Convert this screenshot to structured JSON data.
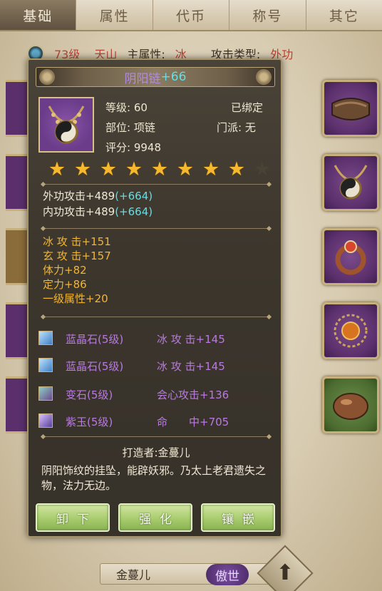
{
  "tabs": [
    "基础",
    "属性",
    "代币",
    "称号",
    "其它"
  ],
  "bg_stats": {
    "level": "73级",
    "sect": "天山",
    "main_attr_label": "主属性:",
    "main_attr_value": "冰",
    "attack_type_label": "攻击类型:",
    "attack_type_value": "外功"
  },
  "item": {
    "name": "阴阳链",
    "plus": "+66",
    "level": "等级: 60",
    "bound": "已绑定",
    "slot": "部位: 项链",
    "sect": "门派: 无",
    "score": "评分: 9948",
    "stars_filled": 8,
    "stars_total": 9
  },
  "attack_stats": [
    {
      "text": "外功攻击+489",
      "bonus": "(+664)"
    },
    {
      "text": "内功攻击+489",
      "bonus": "(+664)"
    }
  ],
  "extra_stats": [
    "冰 攻 击+151",
    "玄 攻 击+157",
    "体力+82",
    "定力+86",
    "一级属性+20"
  ],
  "gems": [
    {
      "name": "蓝晶石(5级)",
      "effect": "冰 攻 击+145",
      "icon": "blue-crystal-gem-icon"
    },
    {
      "name": "蓝晶石(5级)",
      "effect": "冰 攻 击+145",
      "icon": "blue-crystal-gem-icon"
    },
    {
      "name": "变石(5级)",
      "effect": "会心攻击+136",
      "icon": "alexandrite-gem-icon"
    },
    {
      "name": "紫玉(5级)",
      "effect": "命　　中+705",
      "icon": "purple-jade-gem-icon"
    }
  ],
  "maker": "打造者:金蔓儿",
  "description": "阴阳饰纹的挂坠，能辟妖邪。乃太上老君遗失之物，法力无边。",
  "buttons": {
    "unequip": "卸下",
    "enhance": "强化",
    "inlay": "镶嵌"
  },
  "bottom": {
    "player_name": "金蔓儿",
    "badge": "傲世"
  },
  "colors": {
    "item_name": "#b489e0",
    "bonus": "#5fe0e6",
    "stat_yellow": "#f2b531",
    "gem_purple": "#b97ae0",
    "button_green": "#a8cc6e"
  }
}
